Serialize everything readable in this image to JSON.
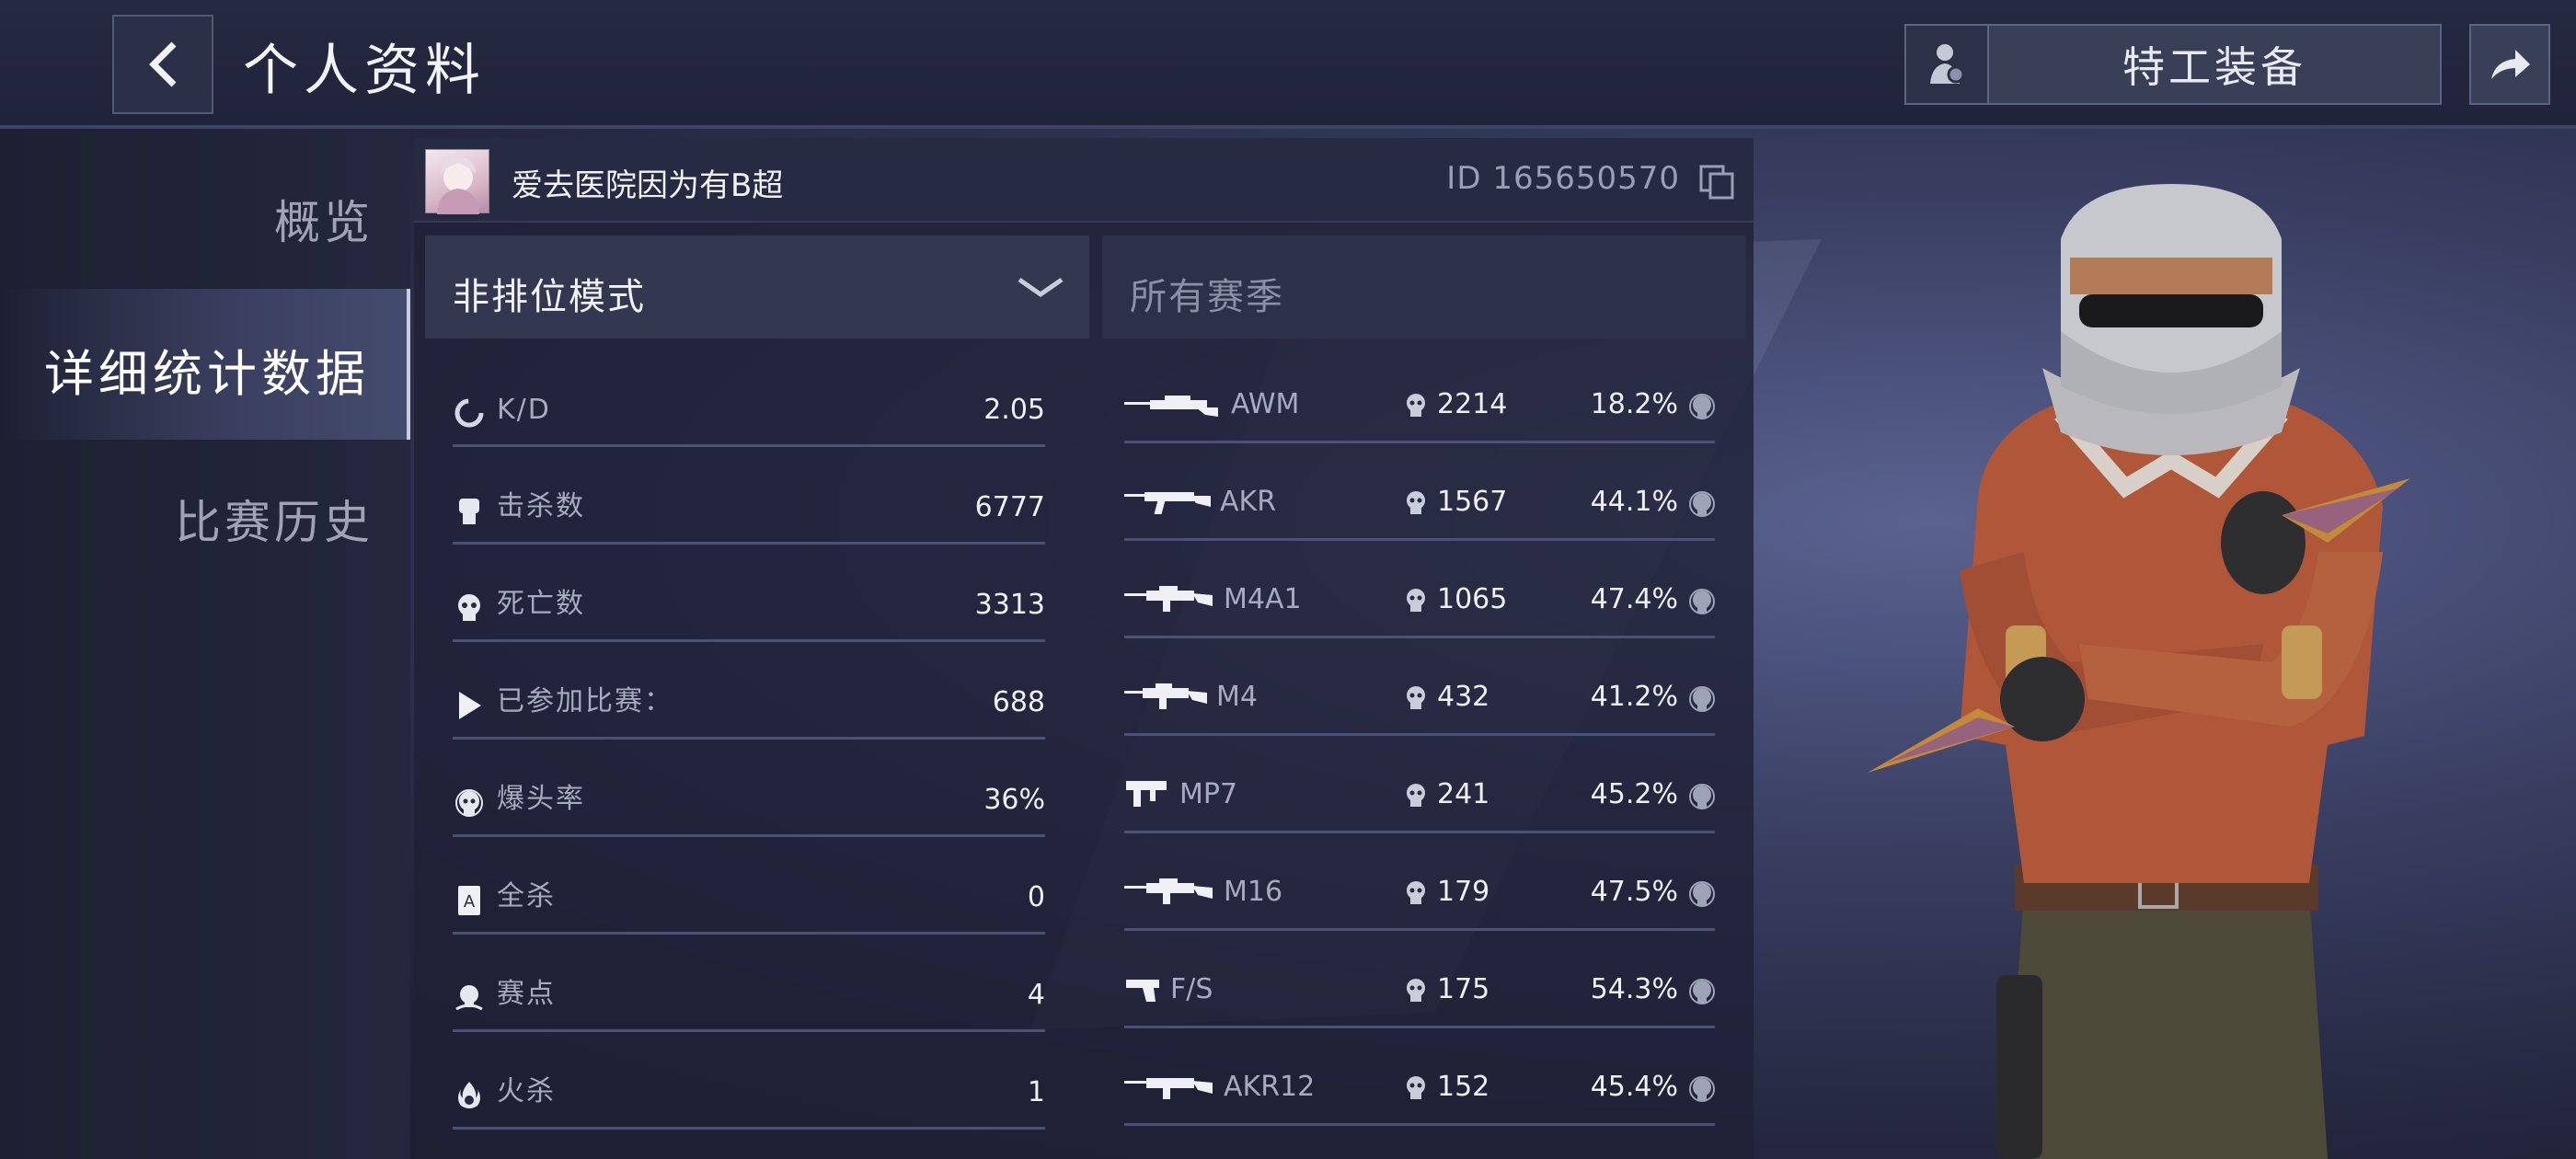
{
  "header": {
    "title": "个人资料",
    "agent_button": "特工装备"
  },
  "nav": {
    "items": [
      "概览",
      "详细统计数据",
      "比赛历史"
    ],
    "active_index": 1
  },
  "profile": {
    "nickname": "爱去医院因为有B超",
    "id_text": "ID 165650570"
  },
  "filters": {
    "mode": "非排位模式",
    "season": "所有赛季"
  },
  "stats": [
    {
      "icon": "kd-icon",
      "label": "K/D",
      "value": "2.05"
    },
    {
      "icon": "fist-icon",
      "label": "击杀数",
      "value": "6777"
    },
    {
      "icon": "skull-icon",
      "label": "死亡数",
      "value": "3313"
    },
    {
      "icon": "play-icon",
      "label": "已参加比赛：",
      "value": "688"
    },
    {
      "icon": "headshot-icon",
      "label": "爆头率",
      "value": "36%"
    },
    {
      "icon": "ace-card-icon",
      "label": "全杀",
      "value": "0"
    },
    {
      "icon": "match-point-icon",
      "label": "赛点",
      "value": "4"
    },
    {
      "icon": "fire-skull-icon",
      "label": "火杀",
      "value": "1"
    }
  ],
  "weapons": [
    {
      "name": "AWM",
      "kills": "2214",
      "headshot_pct": "18.2%"
    },
    {
      "name": "AKR",
      "kills": "1567",
      "headshot_pct": "44.1%"
    },
    {
      "name": "M4A1",
      "kills": "1065",
      "headshot_pct": "47.4%"
    },
    {
      "name": "M4",
      "kills": "432",
      "headshot_pct": "41.2%"
    },
    {
      "name": "MP7",
      "kills": "241",
      "headshot_pct": "45.2%"
    },
    {
      "name": "M16",
      "kills": "179",
      "headshot_pct": "47.5%"
    },
    {
      "name": "F/S",
      "kills": "175",
      "headshot_pct": "54.3%"
    },
    {
      "name": "AKR12",
      "kills": "152",
      "headshot_pct": "45.4%"
    }
  ],
  "colors": {
    "accent_border": "#c9ccd9",
    "panel": "#262a42",
    "row_divider": "#4d5274"
  }
}
